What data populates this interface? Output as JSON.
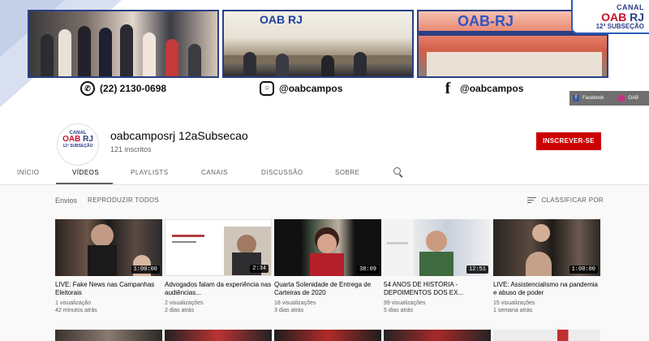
{
  "banner": {
    "phone": "(22) 2130-0698",
    "instagram": "@oabcampos",
    "facebook": "@oabcampos",
    "photo2_sign": "OAB RJ",
    "photo3_sign": "OAB-RJ",
    "canal_top": "CANAL",
    "canal_oab": "OAB",
    "canal_rj": "RJ",
    "canal_sub": "12ª SUBSEÇÃO",
    "strip_facebook": "Facebook",
    "strip_instagram": "OAB"
  },
  "channel": {
    "avatar_canal": "CANAL",
    "avatar_oab": "OAB",
    "avatar_rj": "RJ",
    "avatar_sub": "12ª SUBSEÇÃO",
    "name": "oabcamposrj 12aSubsecao",
    "subscribers": "121 inscritos",
    "subscribe_label": "INSCREVER-SE"
  },
  "tabs": [
    {
      "label": "INÍCIO"
    },
    {
      "label": "VÍDEOS"
    },
    {
      "label": "PLAYLISTS"
    },
    {
      "label": "CANAIS"
    },
    {
      "label": "DISCUSSÃO"
    },
    {
      "label": "SOBRE"
    }
  ],
  "active_tab": "VÍDEOS",
  "section": {
    "title": "Envios",
    "play_all": "REPRODUZIR TODOS",
    "sort": "CLASSIFICAR POR"
  },
  "videos": [
    {
      "title": "LIVE: Fake News nas Campanhas Eleitorais",
      "duration": "1:00:00",
      "views": "1 visualização",
      "age": "42 minutos atrás"
    },
    {
      "title": "Advogados falam da experiência nas audiências...",
      "duration": "2:34",
      "views": "2 visualizações",
      "age": "2 dias atrás"
    },
    {
      "title": "Quarta Solenidade de Entrega de Carteiras de 2020",
      "duration": "38:09",
      "views": "18 visualizações",
      "age": "3 dias atrás"
    },
    {
      "title": "54 ANOS DE HISTÓRIA - DEPOIMENTOS DOS EX...",
      "duration": "12:51",
      "views": "99 visualizações",
      "age": "5 dias atrás"
    },
    {
      "title": "LIVE: Assistencialismo na pandemia e abuso de poder",
      "duration": "1:00:00",
      "views": "15 visualizações",
      "age": "1 semana atrás"
    }
  ]
}
